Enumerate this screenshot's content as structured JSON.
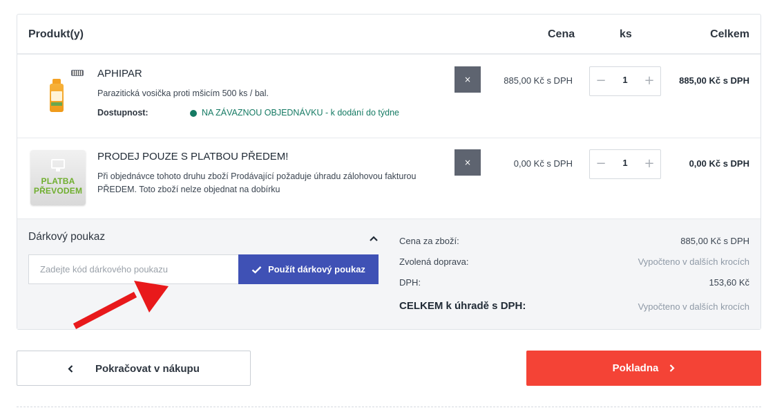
{
  "table": {
    "headers": {
      "product": "Produkt(y)",
      "price": "Cena",
      "qty": "ks",
      "total": "Celkem"
    },
    "items": [
      {
        "name": "APHIPAR",
        "description": "Parazitická vosička proti mšicím 500 ks / bal.",
        "availability_label": "Dostupnost:",
        "availability_text": "NA ZÁVAZNOU OBJEDNÁVKU - k dodání do týdne",
        "availability_color": "#157a63",
        "remove_label": "×",
        "price": "885,00 Kč s DPH",
        "quantity": "1",
        "total": "885,00 Kč s DPH",
        "thumbnail_icon": "bottle-product-icon"
      },
      {
        "name": "PRODEJ POUZE S PLATBOU PŘEDEM!",
        "description": "Při objednávce tohoto druhu zboží Prodávající požaduje úhradu zálohovou fakturou PŘEDEM. Toto zboží nelze objednat na dobírku",
        "thumbnail_text_1": "PLATBA",
        "thumbnail_text_2": "PŘEVODEM",
        "remove_label": "×",
        "price": "0,00 Kč s DPH",
        "quantity": "1",
        "total": "0,00 Kč s DPH",
        "thumbnail_icon": "monitor-icon"
      }
    ],
    "qty_minus": "−",
    "qty_plus": "+"
  },
  "gift": {
    "title": "Dárkový poukaz",
    "input_placeholder": "Zadejte kód dárkového poukazu",
    "apply_label": "Použít dárkový poukaz",
    "accent_color": "#3f51b5"
  },
  "summary": {
    "goods_label": "Cena za zboží:",
    "goods_value": "885,00 Kč s DPH",
    "shipping_label": "Zvolená doprava:",
    "shipping_value": "Vypočteno v dalších krocích",
    "vat_label": "DPH:",
    "vat_value": "153,60 Kč",
    "total_label": "CELKEM k úhradě s DPH:",
    "total_value": "Vypočteno v dalších krocích"
  },
  "actions": {
    "continue_label": "Pokračovat v nákupu",
    "checkout_label": "Pokladna",
    "checkout_color": "#f44336"
  },
  "annotation": {
    "arrow_color": "#e8191b"
  }
}
